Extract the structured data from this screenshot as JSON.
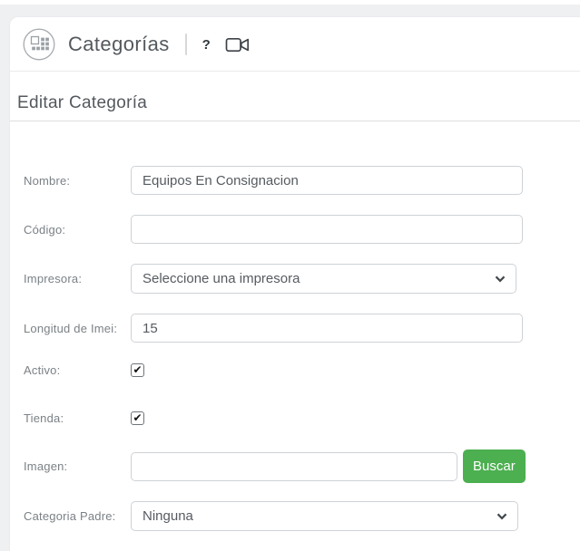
{
  "header": {
    "title": "Categorías",
    "help_label": "?"
  },
  "section": {
    "title": "Editar Categoría"
  },
  "form": {
    "fields": [
      {
        "label": "Nombre:",
        "type": "text",
        "value": "Equipos En Consignacion"
      },
      {
        "label": "Código:",
        "type": "text",
        "value": ""
      },
      {
        "label": "Impresora:",
        "type": "select",
        "value": "Seleccione una impresora"
      },
      {
        "label": "Longitud de Imei:",
        "type": "text",
        "value": "15"
      },
      {
        "label": "Activo:",
        "type": "checkbox",
        "checked": true
      },
      {
        "label": "Tienda:",
        "type": "checkbox",
        "checked": true
      },
      {
        "label": "Imagen:",
        "type": "text-with-button",
        "value": "",
        "button_label": "Buscar"
      },
      {
        "label": "Categoria Padre:",
        "type": "select",
        "value": "Ninguna"
      }
    ]
  },
  "icons": {
    "checkmark": "✔"
  },
  "colors": {
    "accent_green": "#4caf50",
    "page_background": "#eef0f2",
    "text_primary": "#54595e",
    "text_label": "#7b8186",
    "input_border": "#ced2d6"
  }
}
